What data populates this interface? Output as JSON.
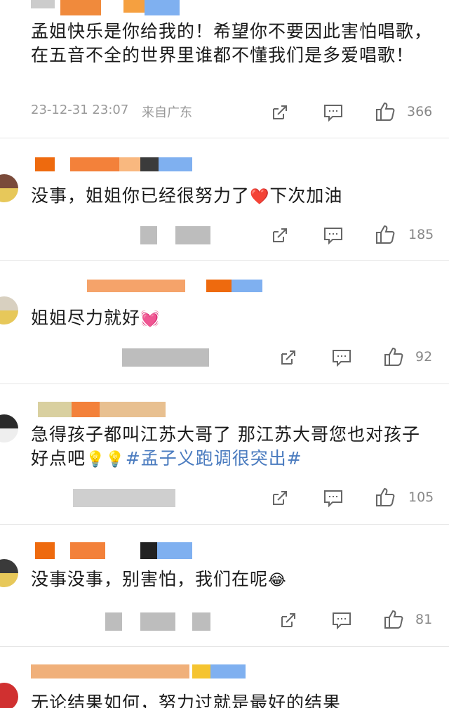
{
  "comments": [
    {
      "text": "孟姐快乐是你给我的！希望你不要因此害怕唱歌，在五音不全的世界里谁都不懂我们是多爱唱歌！",
      "date": "23-12-31 23:07",
      "location": "来自广东",
      "likes": "366"
    },
    {
      "text": "没事，姐姐你已经很努力了",
      "emoji": "❤️",
      "text_after": "下次加油",
      "likes": "185"
    },
    {
      "text": "姐姐尽力就好",
      "emoji": "💓",
      "likes": "92"
    },
    {
      "text": "急得孩子都叫江苏大哥了 那江苏大哥您也对孩子好点吧",
      "emoji": "💡💡",
      "hashtag": "#孟子义跑调很突出#",
      "likes": "105"
    },
    {
      "text": "没事没事，别害怕，我们在呢",
      "emoji": "😂",
      "likes": "81"
    },
    {
      "text": "无论结果如何，努力过就是最好的结果"
    }
  ],
  "icons": {
    "share": "share-icon",
    "comment": "comment-icon",
    "like": "thumbs-up-icon"
  },
  "colors": {
    "mask_orange": "#ee6a0e",
    "mask_blue": "#6aa5ee",
    "hashtag": "#4a7bbf"
  }
}
